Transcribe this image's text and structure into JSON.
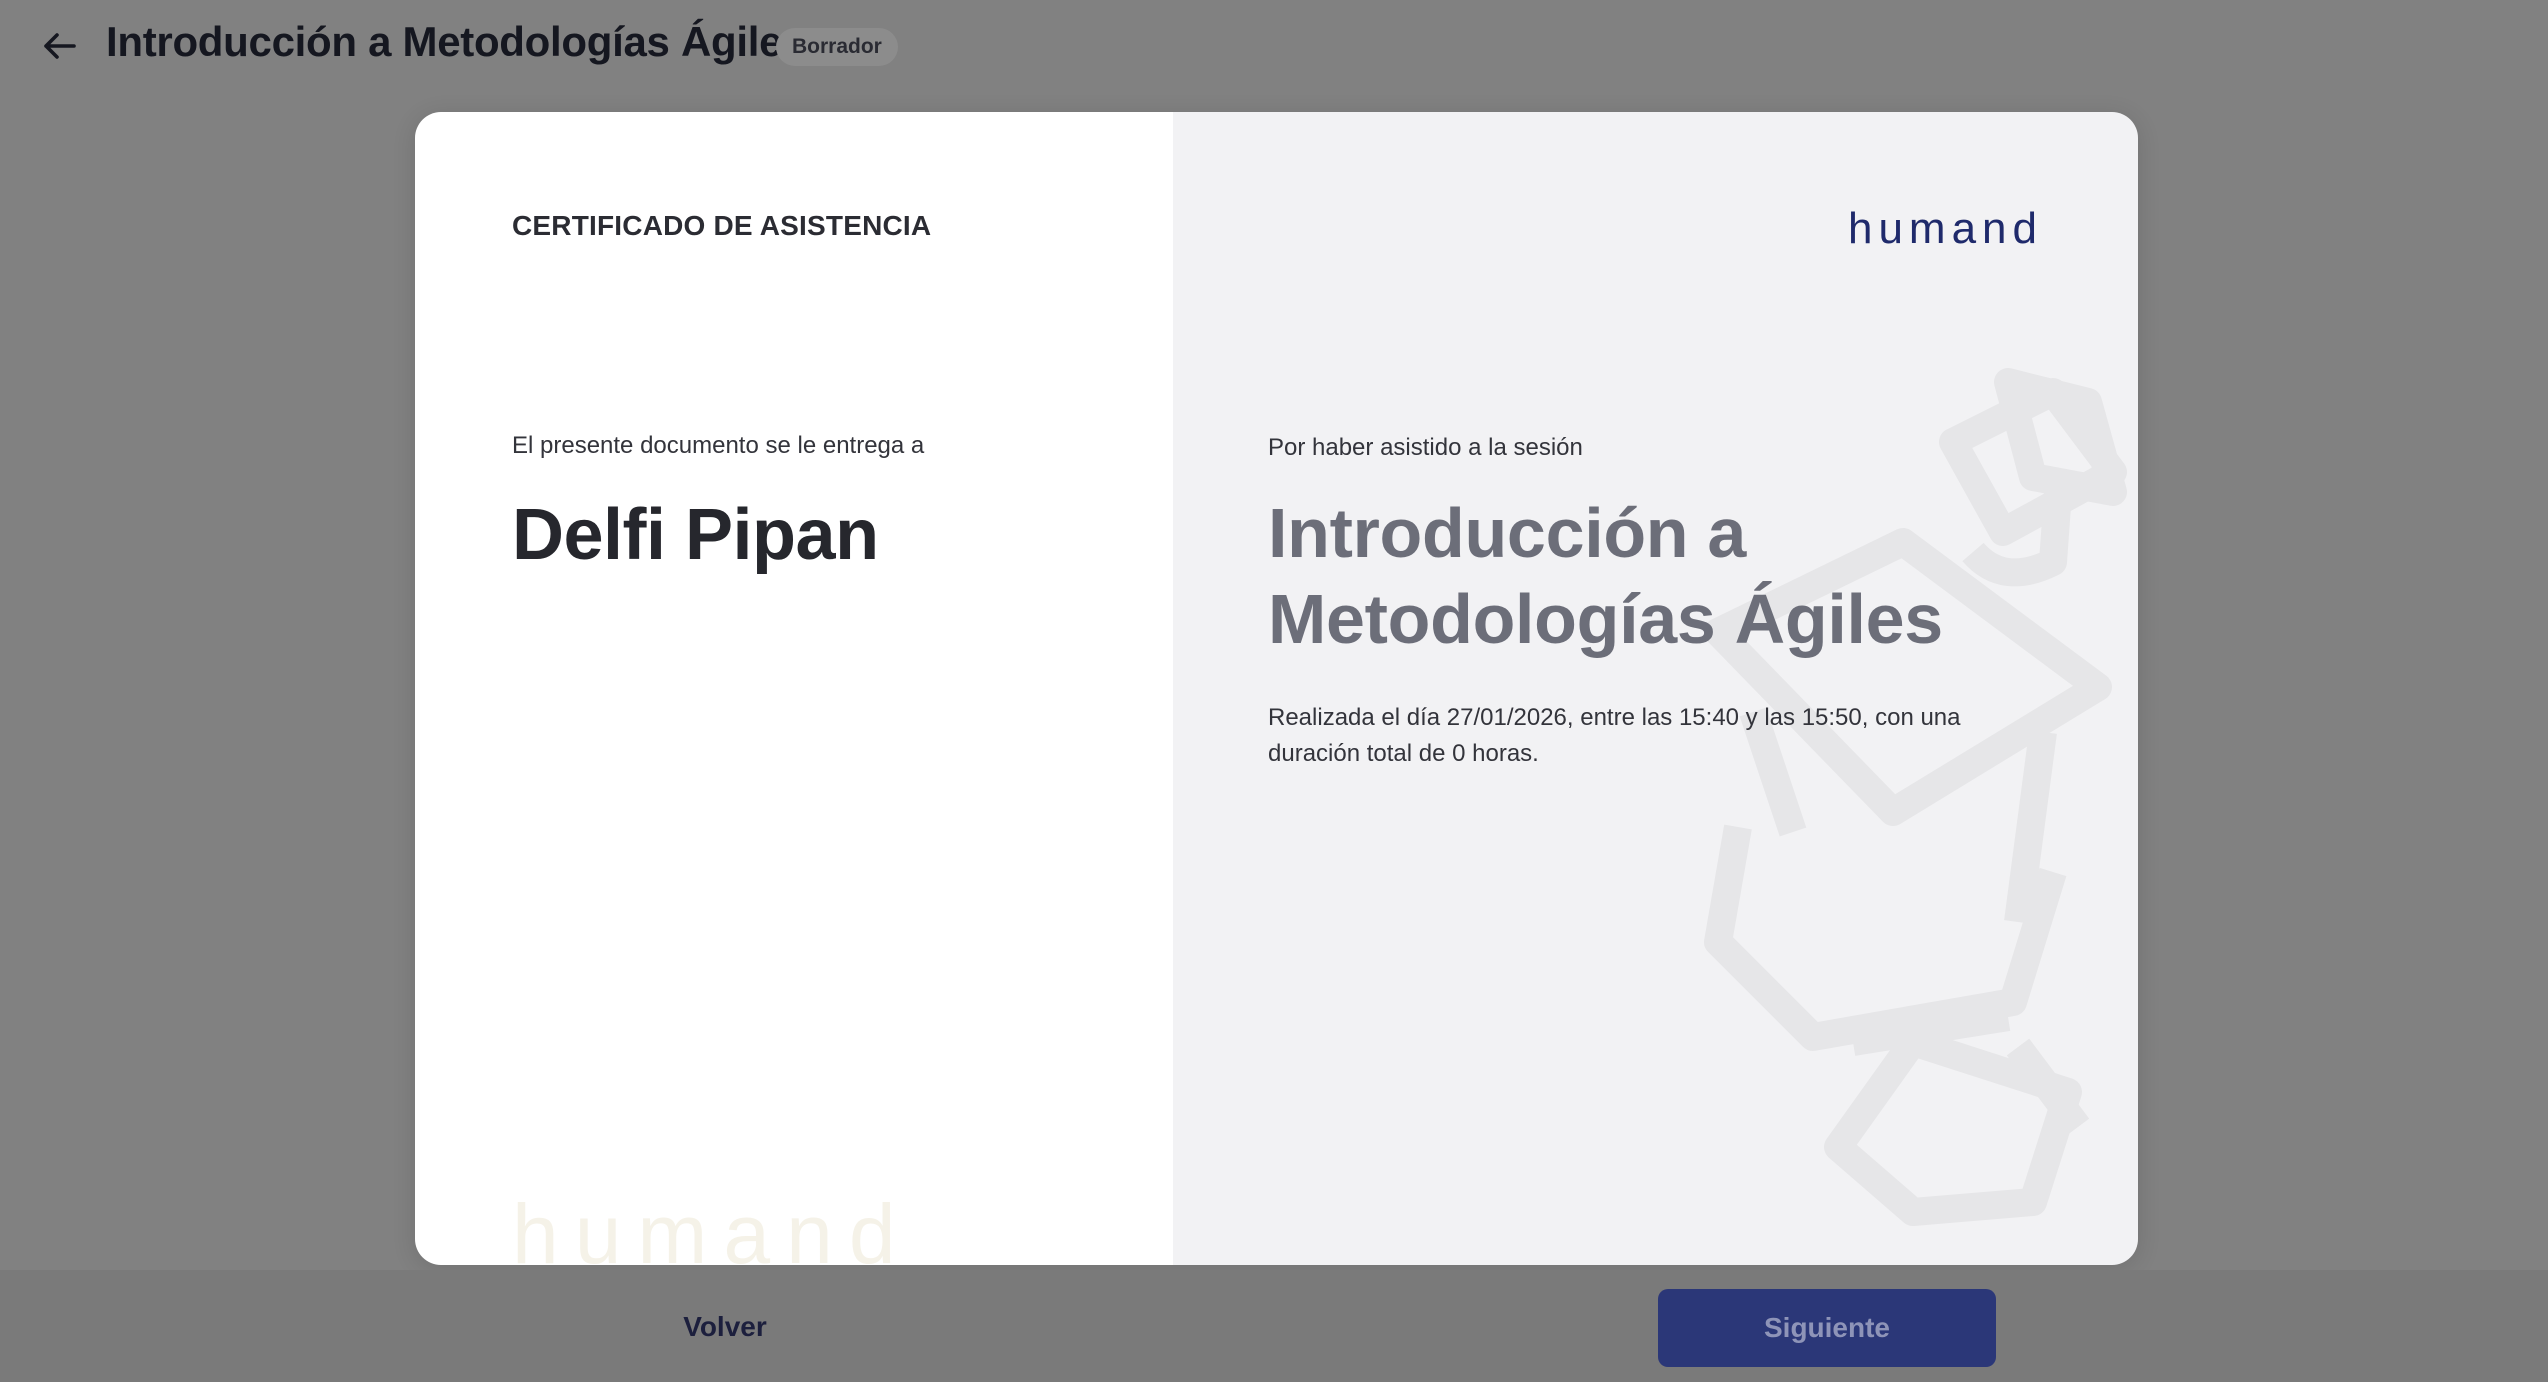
{
  "header": {
    "back_icon": "arrow-left-icon",
    "title": "Introducción a Metodologías Ágiles",
    "status": "Borrador"
  },
  "certificate": {
    "heading": "CERTIFICADO DE ASISTENCIA",
    "presented_text": "El presente documento se le entrega a",
    "recipient": "Delfi Pipan",
    "watermark_logo": "humand",
    "brand_logo": "humand",
    "attended_text": "Por haber asistido a la sesión",
    "session_title": "Introducción a Metodologías Ágiles",
    "session_details": "Realizada el día 27/01/2026, entre las 15:40 y las 15:50, con una duración total de 0 horas.",
    "decoration_icon": "graduation-cap-icon"
  },
  "footer": {
    "back_label": "Volver",
    "next_label": "Siguiente"
  },
  "colors": {
    "overlay": "#818181",
    "brand": "#1f2a6b",
    "primary_button": "#2b3778"
  }
}
